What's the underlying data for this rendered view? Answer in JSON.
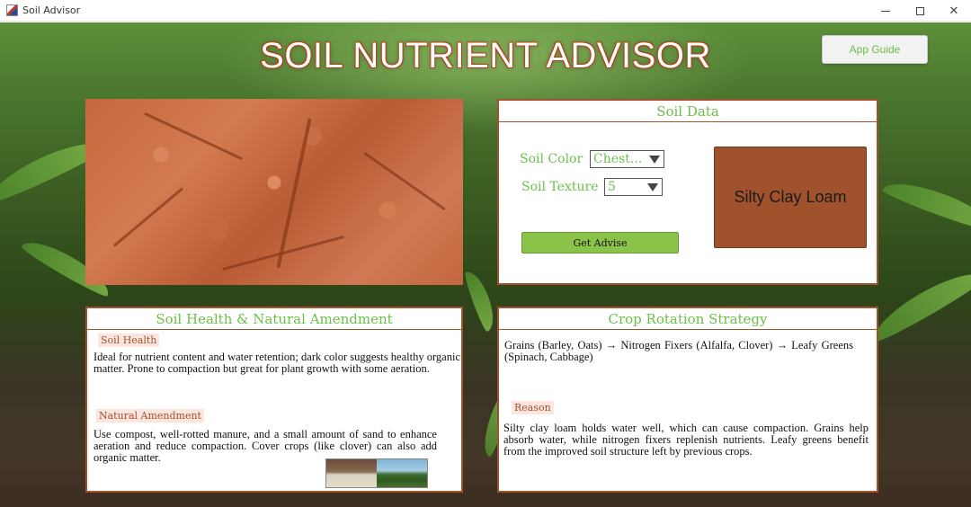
{
  "window": {
    "title": "Soil Advisor",
    "minimize_icon": "minimize-icon",
    "maximize_icon": "maximize-icon",
    "close_label": "✕"
  },
  "header": {
    "title": "SOIL NUTRIENT ADVISOR",
    "app_guide_label": "App Guide"
  },
  "soil_data": {
    "heading": "Soil Data",
    "color_label": "Soil Color",
    "color_value": "Chest...",
    "texture_label": "Soil Texture",
    "texture_value": "5",
    "get_advise_label": "Get Advise",
    "result": "Silty Clay Loam",
    "result_color": "#a0522d"
  },
  "soil_health": {
    "heading": "Soil Health & Natural Amendment",
    "health_tag": "Soil Health",
    "health_text": "Ideal for nutrient content and water retention; dark color suggests healthy organic matter. Prone to compaction but great for plant growth with some aeration.",
    "amendment_tag": "Natural Amendment",
    "amendment_text": "Use compost, well-rotted manure, and a small amount of sand to enhance aeration and reduce compaction. Cover crops (like clover) can also add organic matter."
  },
  "crop_rotation": {
    "heading": "Crop Rotation Strategy",
    "strategy_text": "Grains (Barley, Oats) → Nitrogen Fixers (Alfalfa, Clover) → Leafy Greens (Spinach, Cabbage)",
    "reason_tag": "Reason",
    "reason_text": "Silty clay loam holds water well, which can cause compaction. Grains help absorb water, while nitrogen fixers replenish nutrients. Leafy greens benefit from the improved soil structure left by previous crops."
  },
  "colors": {
    "accent_green": "#6cc04a",
    "border_brown": "#a0522d",
    "button_green": "#8bc34a"
  }
}
